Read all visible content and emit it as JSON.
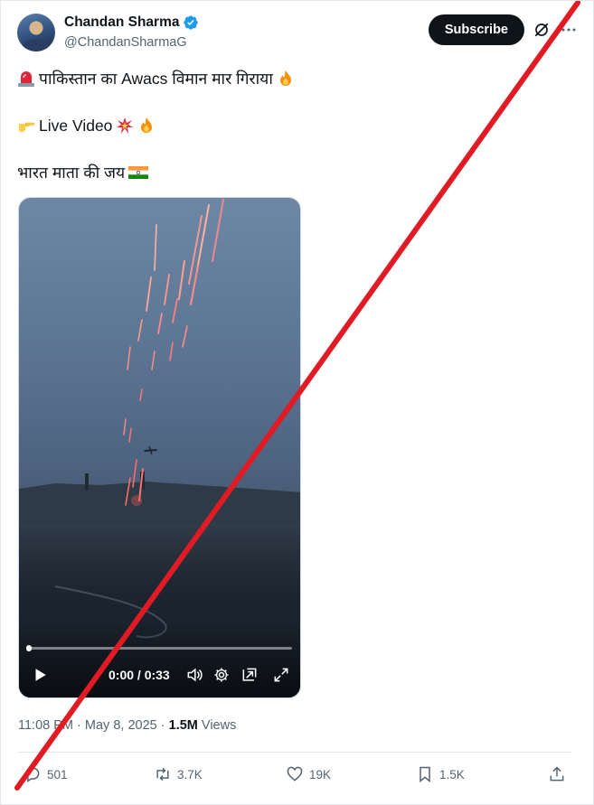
{
  "author": {
    "display_name": "Chandan Sharma",
    "handle": "@ChandanSharmaG"
  },
  "header": {
    "subscribe_label": "Subscribe"
  },
  "tweet": {
    "line1": "पाकिस्तान का Awacs विमान मार गिराया",
    "line2": "Live Video",
    "line3": "भारत माता की जय"
  },
  "video": {
    "time_display": "0:00 / 0:33",
    "progress": 0.0
  },
  "meta": {
    "time": "11:08 PM",
    "separator1": "·",
    "date": "May 8, 2025",
    "separator2": "·",
    "views_count": "1.5M",
    "views_label": "Views"
  },
  "actions": {
    "replies": "501",
    "reposts": "3.7K",
    "likes": "19K",
    "bookmarks": "1.5K"
  },
  "colors": {
    "verified_badge": "#1d9bf0",
    "overlay_slash": "#e01b24",
    "subscribe_bg": "#0f1419",
    "muted_text": "#536471"
  }
}
